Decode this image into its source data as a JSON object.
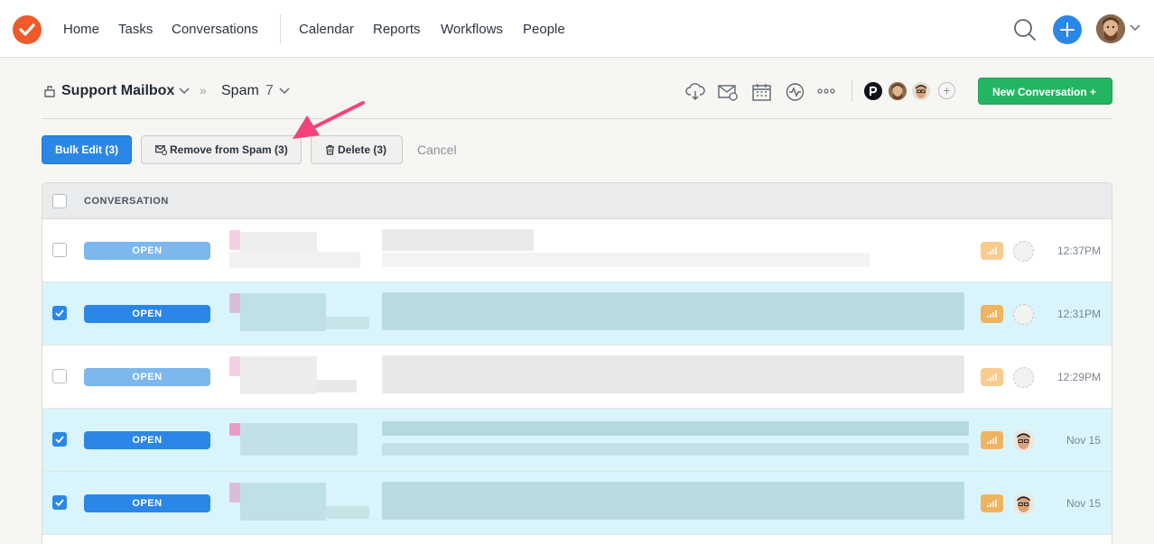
{
  "nav": {
    "items": [
      "Home",
      "Tasks",
      "Conversations",
      "Calendar",
      "Reports",
      "Workflows",
      "People"
    ]
  },
  "header": {
    "mailbox_name": "Support Mailbox",
    "breadcrumb_separator": "»",
    "folder_name": "Spam",
    "folder_count": "7",
    "new_conversation_label": "New Conversation +"
  },
  "toolbar": {
    "bulk_edit_label": "Bulk Edit (3)",
    "remove_spam_label": "Remove from Spam (3)",
    "delete_label": "Delete (3)",
    "cancel_label": "Cancel"
  },
  "table": {
    "column_header": "CONVERSATION",
    "rows": [
      {
        "status": "OPEN",
        "selected": false,
        "time": "12:37PM",
        "assignee": "none"
      },
      {
        "status": "OPEN",
        "selected": true,
        "time": "12:31PM",
        "assignee": "none"
      },
      {
        "status": "OPEN",
        "selected": false,
        "time": "12:29PM",
        "assignee": "none"
      },
      {
        "status": "OPEN",
        "selected": true,
        "time": "Nov 15",
        "assignee": "agent"
      },
      {
        "status": "OPEN",
        "selected": true,
        "time": "Nov 15",
        "assignee": "agent"
      }
    ]
  },
  "colors": {
    "brand": "#f0592a",
    "primary": "#2b87e7",
    "success": "#24b564",
    "selected_row": "#d9f5fb",
    "priority": "#f5a844",
    "annotation_arrow": "#f2447a"
  },
  "icons": {
    "header": [
      "cloud-download-icon",
      "email-alert-icon",
      "calendar-icon",
      "activity-icon",
      "more-icon"
    ]
  }
}
